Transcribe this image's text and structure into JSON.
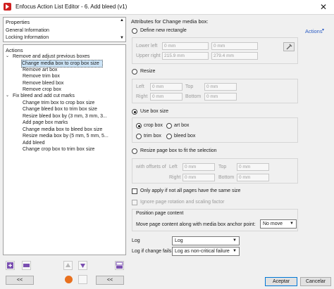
{
  "window": {
    "title": "Enfocus Action List Editor - 6. Add bleed (v1)",
    "close_glyph": "✕"
  },
  "properties": {
    "header": "Properties",
    "items": [
      "General Information",
      "Locking Information"
    ]
  },
  "actions_tree": {
    "header": "Actions",
    "groups": [
      {
        "label": "Remove and adjust previous boxes",
        "items": [
          "Change media box to crop box size",
          "Remove art box",
          "Remove trim box",
          "Remove bleed box",
          "Remove crop box"
        ]
      },
      {
        "label": "Fix bleed and add cut marks",
        "items": [
          "Change trim box to crop box size",
          "Change bleed box to trim box size",
          "Resize bleed box by (3 mm, 3 mm, 3...",
          "Add page box marks",
          "Change media box to bleed box size",
          "Resize media box by (5 mm, 5 mm, 5...",
          "Add bleed",
          "Change crop box to trim box size"
        ]
      }
    ],
    "selected": "Change media box to crop box size"
  },
  "bottom_left": {
    "prev_label": "<<",
    "next_label": "<<"
  },
  "attributes": {
    "title": "Attributes for Change media box:",
    "actions_link": "Actions",
    "define_rect": {
      "label": "Define new rectangle",
      "lower_left": "Lower left",
      "ll_x": "0 mm",
      "ll_y": "0 mm",
      "upper_right": "Upper right",
      "ur_x": "215.9 mm",
      "ur_y": "279.4 mm"
    },
    "resize": {
      "label": "Resize",
      "left": "Left",
      "left_val": "0 mm",
      "top": "Top",
      "top_val": "0 mm",
      "right": "Right",
      "right_val": "0 mm",
      "bottom": "Bottom",
      "bottom_val": "0 mm"
    },
    "use_box": {
      "label": "Use box size",
      "options": [
        "crop box",
        "art box",
        "trim box",
        "bleed box"
      ],
      "selected": "crop box"
    },
    "resize_fit": {
      "label": "Resize page box to fit the selection",
      "offsets": "with offsets of",
      "left": "Left",
      "left_val": "0 mm",
      "top": "Top",
      "top_val": "0 mm",
      "right": "Right",
      "right_val": "0 mm",
      "bottom": "Bottom",
      "bottom_val": "0 mm"
    },
    "only_apply": "Only apply if not all pages have the same size",
    "ignore_rotation": "Ignore page rotation and scaling factor",
    "position": {
      "title": "Position page content",
      "label": "Move page content along with media box anchor point:",
      "value": "No move"
    },
    "log": {
      "label": "Log",
      "value": "Log"
    },
    "log_fail": {
      "label": "Log if change fails",
      "value": "Log as non-critical failure"
    },
    "accept": "Aceptar",
    "cancel": "Cancelar"
  },
  "colors": {
    "selection": "#cce4f7",
    "link": "#2a5cc4",
    "accent": "#0078d7"
  }
}
